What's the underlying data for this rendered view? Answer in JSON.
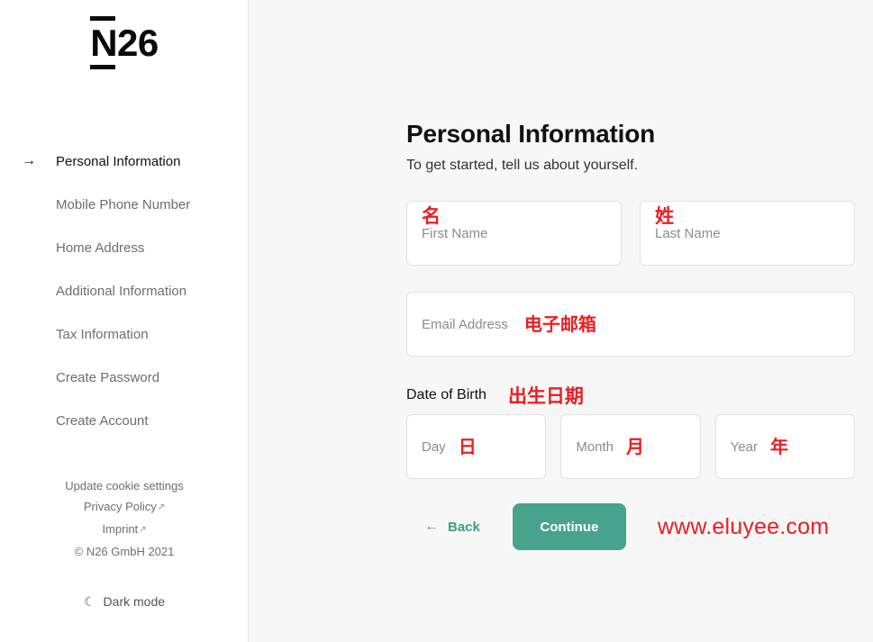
{
  "brand": {
    "logo_text": "N26"
  },
  "sidebar": {
    "nav_items": [
      {
        "label": "Personal Information",
        "active": true,
        "arrow": "→"
      },
      {
        "label": "Mobile Phone Number",
        "active": false
      },
      {
        "label": "Home Address",
        "active": false
      },
      {
        "label": "Additional Information",
        "active": false
      },
      {
        "label": "Tax Information",
        "active": false
      },
      {
        "label": "Create Password",
        "active": false
      },
      {
        "label": "Create Account",
        "active": false
      }
    ],
    "footer": {
      "cookie_settings": "Update cookie settings",
      "privacy_policy": "Privacy Policy",
      "imprint": "Imprint",
      "external_arrow": "↗",
      "copyright": "© N26 GmbH 2021",
      "dark_mode": "Dark mode",
      "moon_icon": "☾"
    }
  },
  "main": {
    "title": "Personal Information",
    "subtitle": "To get started, tell us about yourself.",
    "fields": {
      "first_name": {
        "placeholder": "First Name",
        "value": "",
        "annotation": "名"
      },
      "last_name": {
        "placeholder": "Last Name",
        "value": "",
        "annotation": "姓"
      },
      "email": {
        "placeholder": "Email Address",
        "value": "",
        "annotation": "电子邮箱"
      },
      "dob_label": "Date of Birth",
      "dob_annotation": "出生日期",
      "day": {
        "placeholder": "Day",
        "value": "",
        "annotation": "日"
      },
      "month": {
        "placeholder": "Month",
        "value": "",
        "annotation": "月"
      },
      "year": {
        "placeholder": "Year",
        "value": "",
        "annotation": "年"
      }
    },
    "actions": {
      "back_label": "Back",
      "back_arrow": "←",
      "continue_label": "Continue"
    },
    "watermark": "www.eluyee.com"
  },
  "colors": {
    "accent": "#48a38c",
    "annotation_red": "#ef1c22",
    "main_bg": "#f7f7f7",
    "sidebar_bg": "#ffffff"
  }
}
